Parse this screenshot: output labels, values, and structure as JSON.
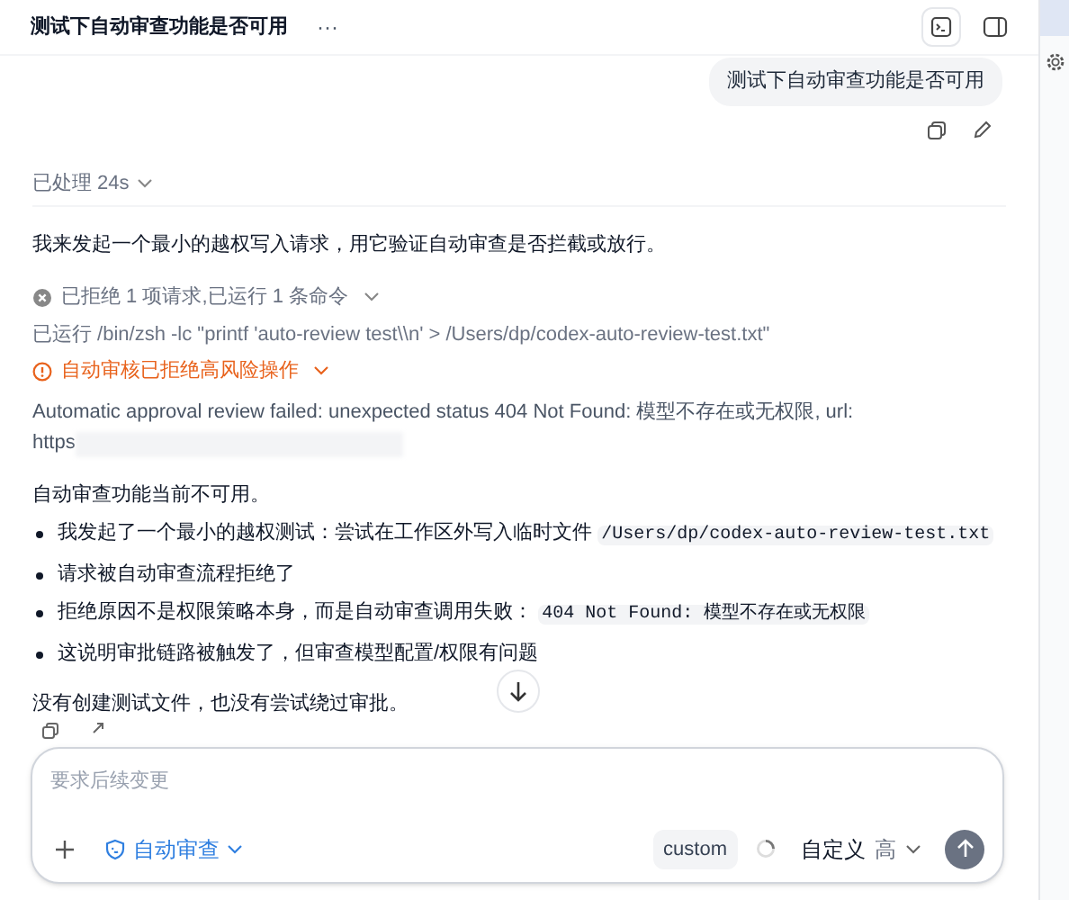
{
  "header": {
    "title": "测试下自动审查功能是否可用",
    "more": "···"
  },
  "user_message": "测试下自动审查功能是否可用",
  "processed": "已处理 24s",
  "intro": "我来发起一个最小的越权写入请求，用它验证自动审查是否拦截或放行。",
  "activity": {
    "summary": "已拒绝 1 项请求,已运行 1 条命令",
    "command": "已运行 /bin/zsh -lc \"printf 'auto-review test\\\\n' > /Users/dp/codex-auto-review-test.txt\"",
    "warning": "自动审核已拒绝高风险操作",
    "error": "Automatic approval review failed: unexpected status 404 Not Found: 模型不存在或无权限, url:",
    "url_prefix": "https"
  },
  "conclusion": "自动审查功能当前不可用。",
  "bullets": [
    {
      "parts": [
        {
          "kind": "text",
          "text": "我发起了一个最小的越权测试：尝试在工作区外写入临时文件 "
        },
        {
          "kind": "code",
          "text": "/Users/dp/codex-auto-review-test.txt"
        }
      ]
    },
    {
      "parts": [
        {
          "kind": "text",
          "text": "请求被自动审查流程拒绝了"
        }
      ]
    },
    {
      "parts": [
        {
          "kind": "text",
          "text": "拒绝原因不是权限策略本身，而是自动审查调用失败： "
        },
        {
          "kind": "code",
          "text": "404 Not Found: 模型不存在或无权限"
        }
      ]
    },
    {
      "parts": [
        {
          "kind": "text",
          "text": "这说明审批链路被触发了，但审查模型配置/权限有问题"
        }
      ]
    }
  ],
  "closing": "没有创建测试文件，也没有尝试绕过审批。",
  "composer": {
    "placeholder": "要求后续变更",
    "mode": "自动审查",
    "model": "custom",
    "preset": "自定义",
    "effort": "高"
  }
}
